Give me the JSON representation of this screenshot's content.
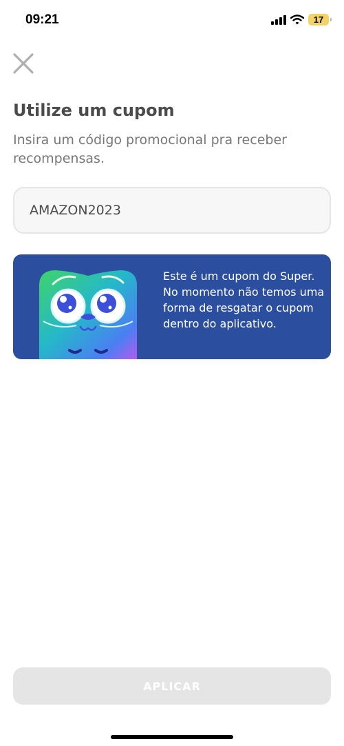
{
  "status_bar": {
    "time": "09:21",
    "battery_level": "17",
    "icons": [
      "cellular-signal-icon",
      "wifi-icon",
      "battery-icon"
    ],
    "battery_color": "#f1d36a"
  },
  "header": {
    "close_icon": "close-icon"
  },
  "main": {
    "title": "Utilize um cupom",
    "subtitle": "Insira um código promocional pra receber recompensas.",
    "coupon_value": "AMAZON2023"
  },
  "info_card": {
    "text": "Este é um cupom do Super. No momento não temos uma forma de resgatar o cupom dentro do aplicativo.",
    "background_color": "#2b4f9e",
    "illustration": "super-mascot-illustration"
  },
  "footer": {
    "apply_label": "APLICAR",
    "apply_disabled_color": "#e5e5e5"
  }
}
